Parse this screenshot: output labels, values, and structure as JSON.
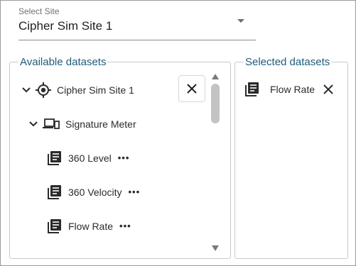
{
  "select_site": {
    "label": "Select Site",
    "value": "Cipher Sim Site 1"
  },
  "available": {
    "legend": "Available datasets",
    "site": {
      "label": "Cipher Sim Site 1"
    },
    "meter": {
      "label": "Signature Meter"
    },
    "items": [
      {
        "label": "360 Level",
        "more": "•••"
      },
      {
        "label": "360 Velocity",
        "more": "•••"
      },
      {
        "label": "Flow Rate",
        "more": "•••"
      }
    ]
  },
  "selected": {
    "legend": "Selected datasets",
    "items": [
      {
        "label": "Flow Rate"
      }
    ]
  },
  "colors": {
    "legend": "#1f5b7a",
    "text": "#2b2b2b",
    "border": "#c9c9c9"
  }
}
